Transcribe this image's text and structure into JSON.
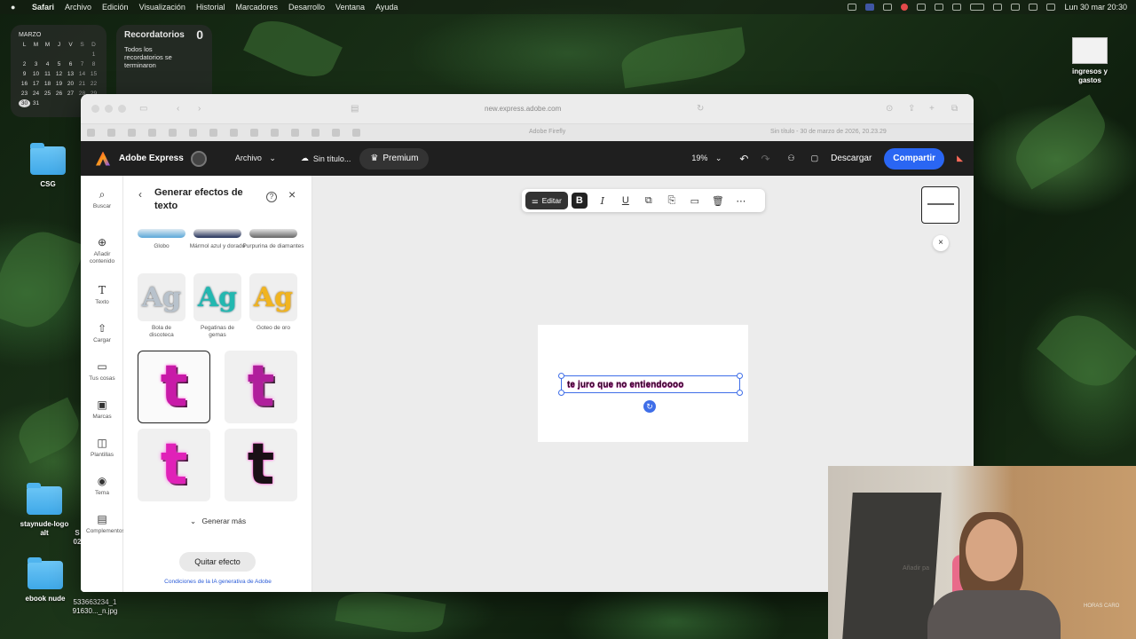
{
  "menubar": {
    "app": "Safari",
    "items": [
      "Archivo",
      "Edición",
      "Visualización",
      "Historial",
      "Marcadores",
      "Desarrollo",
      "Ventana",
      "Ayuda"
    ],
    "clock": "Lun 30 mar  20:30"
  },
  "calendar": {
    "month": "MARZO",
    "weekdays": [
      "L",
      "M",
      "M",
      "J",
      "V",
      "S",
      "D"
    ],
    "days": [
      "",
      "",
      "",
      "",
      "",
      "",
      "1",
      "2",
      "3",
      "4",
      "5",
      "6",
      "7",
      "8",
      "9",
      "10",
      "11",
      "12",
      "13",
      "14",
      "15",
      "16",
      "17",
      "18",
      "19",
      "20",
      "21",
      "22",
      "23",
      "24",
      "25",
      "26",
      "27",
      "28",
      "29",
      "30",
      "31"
    ],
    "today": "30"
  },
  "reminders": {
    "title": "Recordatorios",
    "count": "0",
    "status": "Todos los recordatorios se terminaron"
  },
  "desktop": {
    "csg": "CSG",
    "ingresos": "ingresos y gastos",
    "staynude": "staynude-logo alt",
    "ebook": "ebook nude",
    "jpg": "533663234_1 91630..._n.jpg",
    "partial_s": "S",
    "partial_02": "02"
  },
  "browser": {
    "url": "new.express.adobe.com",
    "tab1": "Adobe Firefly",
    "tab2": "Sin título - 30 de marzo de 2026, 20.23.29"
  },
  "header": {
    "app_name": "Adobe Express",
    "file_menu": "Archivo",
    "doc_title": "Sin título...",
    "premium": "Premium",
    "zoom": "19%",
    "download": "Descargar",
    "share": "Compartir"
  },
  "rail": {
    "search": "Buscar",
    "add": "Añadir contenido",
    "text": "Texto",
    "upload": "Cargar",
    "yours": "Tus cosas",
    "brands": "Marcas",
    "templates": "Plantillas",
    "theme": "Tema",
    "addons": "Complementos"
  },
  "panel": {
    "title": "Generar efectos de texto",
    "top_labels": [
      "Globo",
      "Mármol azul y dorado",
      "Purpurina de diamantes"
    ],
    "styles": [
      {
        "label": "Bola de discoteca",
        "glyph": "Ag"
      },
      {
        "label": "Pegatinas de gemas",
        "glyph": "Ag"
      },
      {
        "label": "Goteo de oro",
        "glyph": "Ag"
      }
    ],
    "result_glyph": "t",
    "generate_more": "Generar más",
    "remove_effect": "Quitar efecto",
    "terms": "Condiciones de la IA generativa de Adobe"
  },
  "canvas": {
    "edit_label": "Editar",
    "text_content": "te juro que no entiendoooo"
  },
  "webcam": {
    "wall_text": "Añadir pa",
    "shirt_text": "HORAS CARO"
  }
}
